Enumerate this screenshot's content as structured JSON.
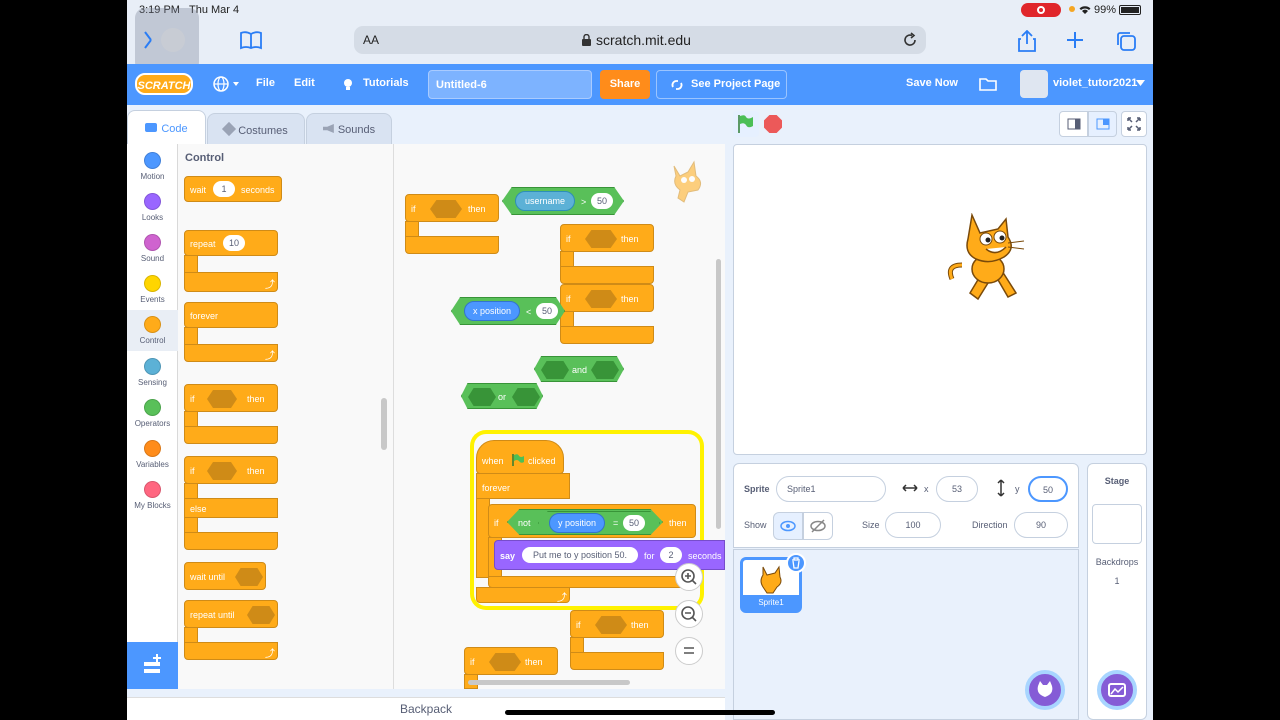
{
  "status_bar": {
    "time": "3:19 PM",
    "date": "Thu Mar 4",
    "battery": "99%"
  },
  "safari": {
    "url": "scratch.mit.edu",
    "text_size": "AA"
  },
  "menu": {
    "logo": "SCRATCH",
    "file": "File",
    "edit": "Edit",
    "tutorials": "Tutorials",
    "project_title": "Untitled-6",
    "share": "Share",
    "see_project": "See Project Page",
    "save_now": "Save Now",
    "username": "violet_tutor2021"
  },
  "tabs": {
    "code": "Code",
    "costumes": "Costumes",
    "sounds": "Sounds"
  },
  "categories": [
    {
      "label": "Motion",
      "color": "#4c97ff"
    },
    {
      "label": "Looks",
      "color": "#9966ff"
    },
    {
      "label": "Sound",
      "color": "#cf63cf"
    },
    {
      "label": "Events",
      "color": "#ffd500"
    },
    {
      "label": "Control",
      "color": "#ffab19"
    },
    {
      "label": "Sensing",
      "color": "#5cb1d6"
    },
    {
      "label": "Operators",
      "color": "#59c059"
    },
    {
      "label": "Variables",
      "color": "#ff8c1a"
    },
    {
      "label": "My Blocks",
      "color": "#ff6680"
    }
  ],
  "palette": {
    "heading": "Control",
    "wait": "wait",
    "wait_value": "1",
    "seconds": "seconds",
    "repeat": "repeat",
    "repeat_value": "10",
    "forever": "forever",
    "if": "if",
    "then": "then",
    "else": "else",
    "wait_until": "wait until",
    "repeat_until": "repeat until"
  },
  "script": {
    "if": "if",
    "then": "then",
    "username": "username",
    "gt": ">",
    "fifty": "50",
    "x_position": "x position",
    "lt": "<",
    "and": "and",
    "or": "or",
    "when": "when",
    "clicked": "clicked",
    "forever": "forever",
    "not": "not",
    "y_position": "y position",
    "eq": "=",
    "say": "say",
    "say_text": "Put me to y position 50.",
    "for": "for",
    "say_secs": "2",
    "seconds": "seconds"
  },
  "backpack": "Backpack",
  "sprite_info": {
    "sprite_label": "Sprite",
    "sprite_name": "Sprite1",
    "x_label": "x",
    "x_value": "53",
    "y_label": "y",
    "y_value": "50",
    "show_label": "Show",
    "size_label": "Size",
    "size_value": "100",
    "direction_label": "Direction",
    "direction_value": "90"
  },
  "sprites": [
    {
      "name": "Sprite1"
    }
  ],
  "stage_panel": {
    "title": "Stage",
    "backdrops_label": "Backdrops",
    "backdrops_count": "1"
  },
  "colors": {
    "accent": "#4c97ff",
    "control": "#ffab19",
    "operators": "#59c059",
    "sensing": "#5cb1d6",
    "looks": "#9966ff"
  }
}
